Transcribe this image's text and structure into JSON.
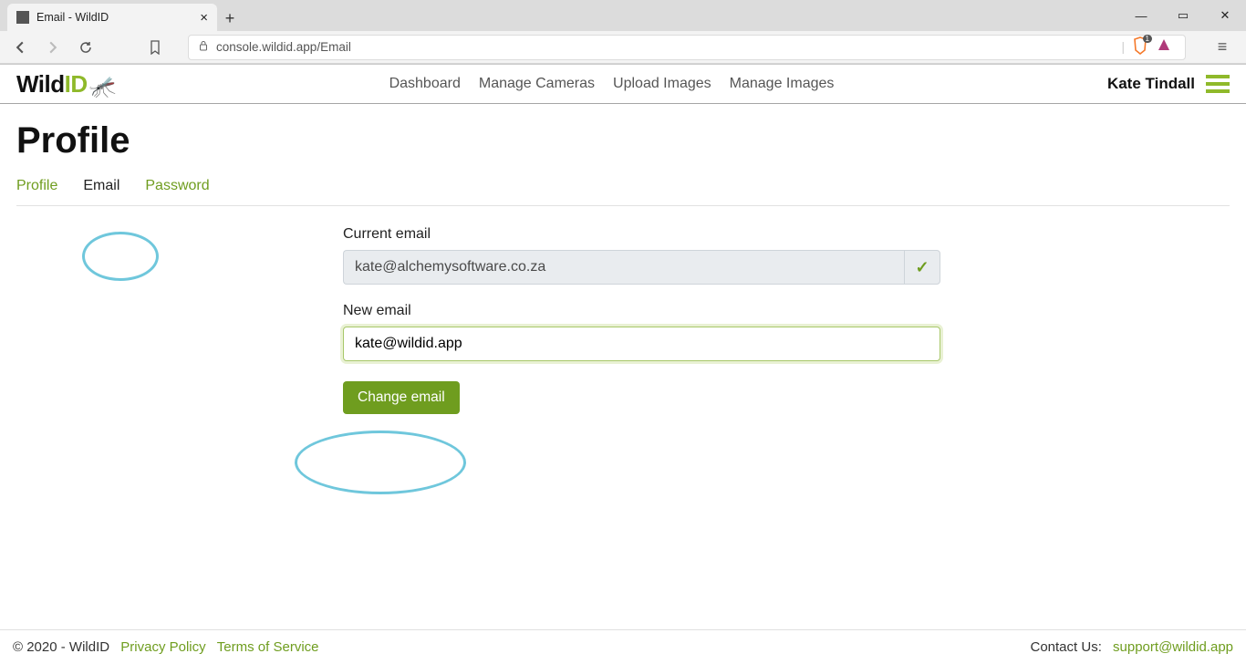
{
  "browser": {
    "tab_title": "Email - WildID",
    "url": "console.wildid.app/Email",
    "shield_count": "1"
  },
  "header": {
    "logo_wild": "Wild",
    "logo_id": "ID",
    "nav": {
      "dashboard": "Dashboard",
      "manage_cameras": "Manage Cameras",
      "upload_images": "Upload Images",
      "manage_images": "Manage Images"
    },
    "username": "Kate Tindall"
  },
  "page": {
    "title": "Profile",
    "tabs": {
      "profile": "Profile",
      "email": "Email",
      "password": "Password"
    }
  },
  "form": {
    "current_email_label": "Current email",
    "current_email_value": "kate@alchemysoftware.co.za",
    "new_email_label": "New email",
    "new_email_value": "kate@wildid.app",
    "submit_label": "Change email"
  },
  "footer": {
    "copyright": "© 2020 - WildID",
    "privacy": "Privacy Policy",
    "terms": "Terms of Service",
    "contact_label": "Contact Us: ",
    "contact_email": "support@wildid.app"
  }
}
